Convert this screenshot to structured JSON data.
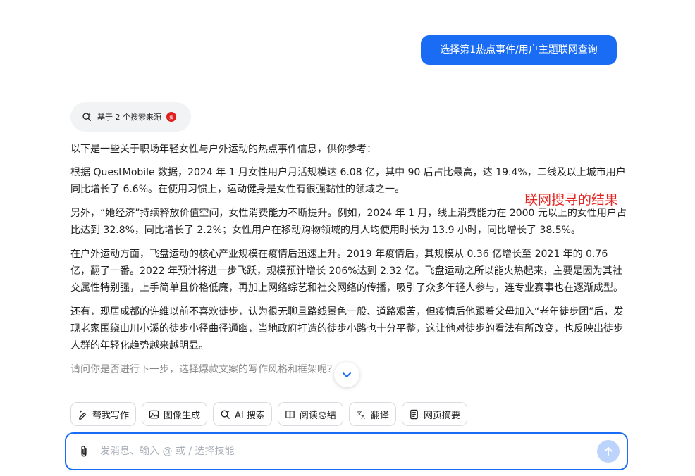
{
  "user_message": "选择第1热点事件/用户主题联网查询",
  "sources": {
    "label": "基于 2 个搜索来源",
    "favicon_text": "搜"
  },
  "answer": {
    "paragraphs": [
      "以下是一些关于职场年轻女性与户外运动的热点事件信息，供你参考：",
      "根据 QuestMobile 数据，2024 年 1 月女性用户月活规模达 6.08 亿，其中 90 后占比最高，达 19.4%，二线及以上城市用户同比增长了 6.6%。在使用习惯上，运动健身是女性有很强黏性的领域之一。",
      "另外，“她经济”持续释放价值空间，女性消费能力不断提升。例如，2024 年 1 月，线上消费能力在 2000 元以上的女性用户占比达到 32.8%，同比增长了 2.2%；女性用户在移动购物领域的月人均使用时长为 13.9 小时，同比增长了 38.5%。",
      "在户外运动方面，飞盘运动的核心产业规模在疫情后迅速上升。2019 年疫情后，其规模从 0.36 亿增长至 2021 年的 0.76 亿，翻了一番。2022 年预计将进一步飞跃，规模预计增长 206%达到 2.32 亿。飞盘运动之所以能火热起来，主要是因为其社交属性特别强，上手简单且价格低廉，再加上网络综艺和社交网络的传播，吸引了众多年轻人参与，连专业赛事也在逐渐成型。",
      "还有，现居成都的许维以前不喜欢徒步，认为很无聊且路线景色一般、道路艰苦，但疫情后他跟着父母加入“老年徒步团”后，发现老家围绕山川小溪的徒步小径曲径通幽，当地政府打造的徒步小路也十分平整，这让他对徒步的看法有所改变，也反映出徒步人群的年轻化趋势越来越明显。",
      "请问你是否进行下一步，选择爆款文案的写作风格和框架呢？"
    ]
  },
  "annotation": "联网搜寻的结果",
  "skills": [
    {
      "label": "帮我写作",
      "icon": "pen-sparkle-icon"
    },
    {
      "label": "图像生成",
      "icon": "image-icon"
    },
    {
      "label": "AI 搜索",
      "icon": "search-sparkle-icon"
    },
    {
      "label": "阅读总结",
      "icon": "read-summary-icon"
    },
    {
      "label": "翻译",
      "icon": "translate-icon"
    },
    {
      "label": "网页摘要",
      "icon": "webpage-summary-icon"
    }
  ],
  "composer": {
    "placeholder": "发消息、输入 @ 或 / 选择技能",
    "value": ""
  },
  "colors": {
    "accent": "#1a6cf5",
    "annotation": "#e4231f",
    "send_disabled": "#bcd3fb"
  }
}
